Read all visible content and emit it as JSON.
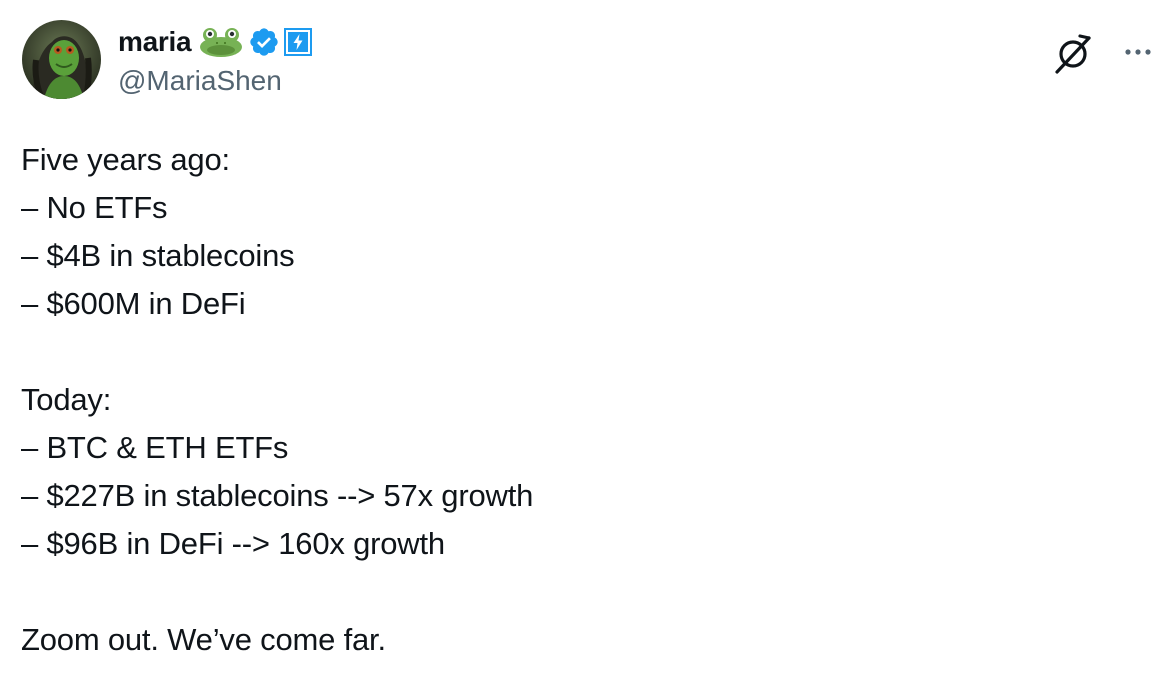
{
  "author": {
    "display_name": "maria",
    "handle": "@MariaShen",
    "badges": [
      "frog-emoji",
      "verified-badge",
      "lightning-badge"
    ],
    "verified_color": "#1d9bf0",
    "lightning_color": "#1d9bf0"
  },
  "actions": {
    "grok_icon": "grok-icon",
    "more_icon": "more-icon"
  },
  "tweet": {
    "lines": [
      "Five years ago:",
      "– No ETFs",
      "– $4B in stablecoins",
      "– $600M in DeFi",
      "",
      "Today:",
      "– BTC & ETH ETFs",
      "– $227B in stablecoins --> 57x growth",
      "– $96B in DeFi --> 160x growth",
      "",
      "Zoom out. We’ve come far."
    ]
  }
}
